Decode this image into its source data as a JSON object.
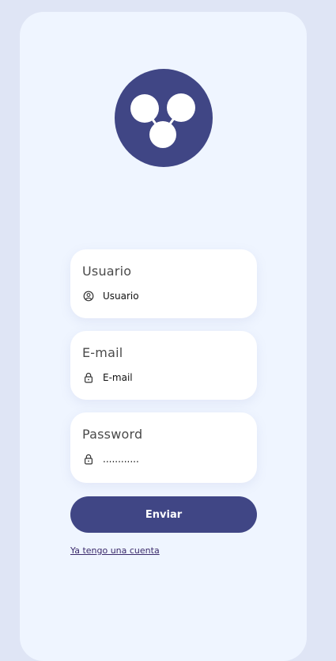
{
  "form": {
    "username": {
      "label": "Usuario",
      "placeholder": "Usuario",
      "icon": "user-circle-icon"
    },
    "email": {
      "label": "E-mail",
      "placeholder": "E-mail",
      "icon": "lock-icon"
    },
    "password": {
      "label": "Password",
      "value": "............",
      "icon": "lock-icon"
    },
    "submit_label": "Enviar",
    "login_link": "Ya tengo una cuenta"
  },
  "colors": {
    "accent": "#404685",
    "background": "#dfe5f5",
    "card": "#eff5ff"
  }
}
